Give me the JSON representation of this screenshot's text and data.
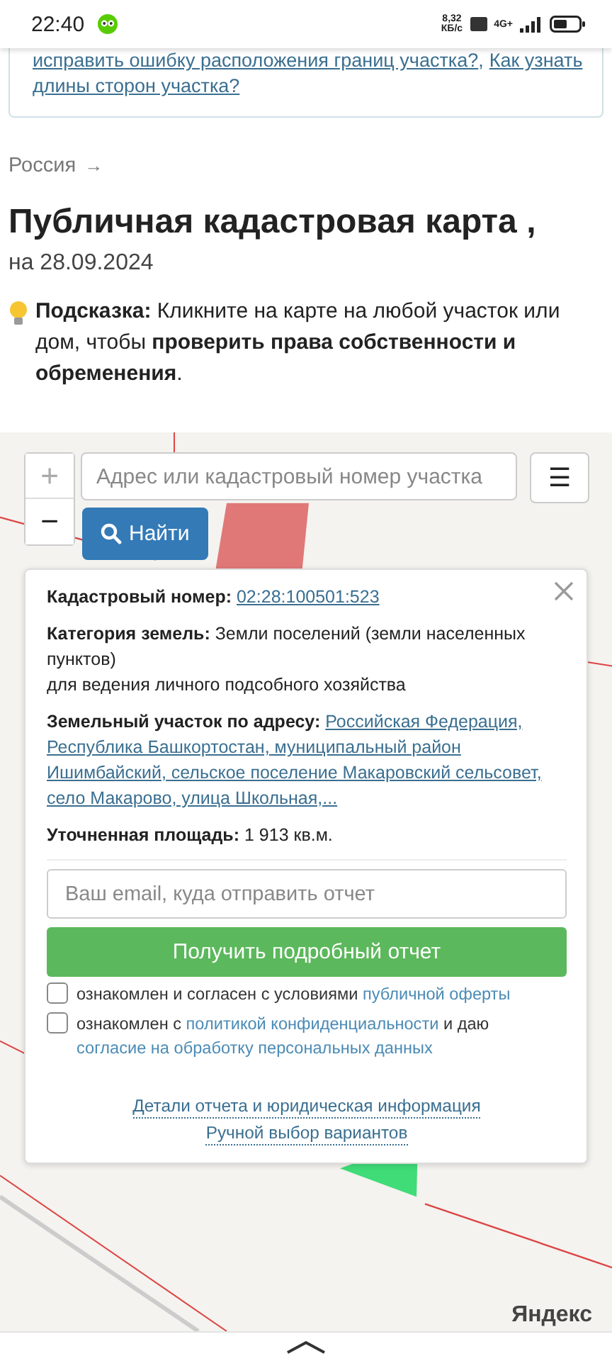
{
  "status_bar": {
    "time": "22:40",
    "speed": "8,32",
    "speed_unit": "КБ/с",
    "network": "4G+"
  },
  "top_card": {
    "lines": [
      [
        {
          "text": "исправить ошибку расположения границ участка?",
          "link": true
        },
        {
          "text": ",",
          "link": false
        },
        {
          "text": "Как узнать",
          "link": true
        }
      ],
      [
        {
          "text": "длины сторон участка?",
          "link": true
        }
      ]
    ]
  },
  "breadcrumb": {
    "label": "Россия",
    "arrow": "→"
  },
  "title": "Публичная кадастровая карта ,",
  "subtitle": "на 28.09.2024",
  "hint": "**Подсказка:** Кликните на карте на любой участок или дом, чтобы **проверить права собственности и обременения**.",
  "map": {
    "zoom_in": "+",
    "zoom_out": "−",
    "search": {
      "placeholder": "Адрес или кадастровый номер участка"
    },
    "menu_button": "☰",
    "find_button": "Найти",
    "attribution": "Яндекс",
    "popup": {
      "fields": [
        {
          "label": "Кадастровый номер:",
          "value": "02:28:100501:523",
          "kind": "link"
        },
        {
          "label": "Категория земель:",
          "value": "Земли поселений (земли населенных пунктов)",
          "extra": "для ведения личного подсобного хозяйства",
          "kind": "text"
        },
        {
          "label": "Земельный участок по адресу:",
          "value": "Российская Федерация, Республика Башкортостан, муниципальный район Ишимбайский, сельское поселение Макаровский сельсовет, село Макарово, улица Школьная,...",
          "kind": "long_link"
        },
        {
          "label": "Уточненная площадь:",
          "value": "1 913 кв.м.",
          "kind": "text"
        }
      ],
      "email": {
        "placeholder": "Ваш email, куда отправить отчет"
      },
      "submit": "Получить подробный отчет",
      "agreements": [
        {
          "checked": false,
          "parts": [
            {
              "text": "ознакомлен и согласен с условиями",
              "link": false
            },
            {
              "text": "публичной оферты",
              "link": true
            }
          ]
        },
        {
          "checked": false,
          "parts": [
            {
              "text": "ознакомлен с",
              "link": false
            },
            {
              "text": "политикой конфиденциальности",
              "link": true
            },
            {
              "text": "и даю",
              "link": false
            },
            {
              "text": "согласие на обработку персональных данных",
              "link": true
            }
          ]
        }
      ],
      "footer_links": [
        "Детали отчета и юридическая информация",
        "Ручной выбор вариантов"
      ]
    }
  }
}
